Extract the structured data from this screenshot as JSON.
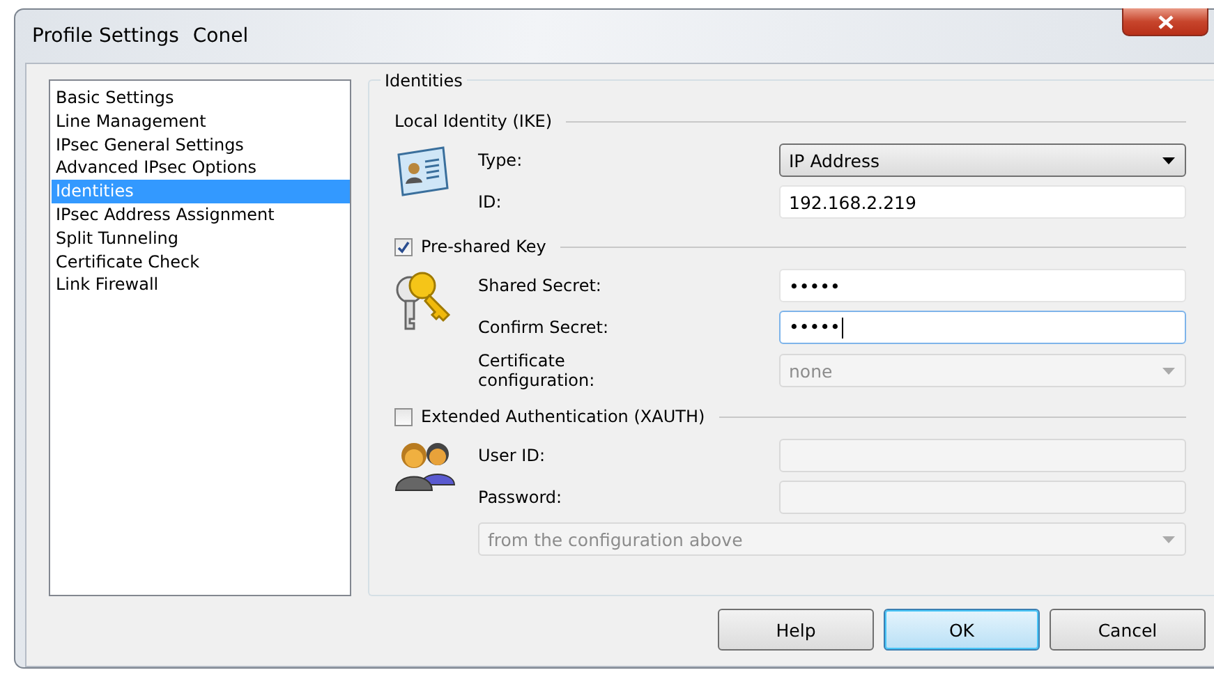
{
  "window": {
    "title": "Profile Settings",
    "subtitle": "Conel"
  },
  "nav": {
    "items": [
      {
        "label": "Basic Settings",
        "selected": false
      },
      {
        "label": "Line Management",
        "selected": false
      },
      {
        "label": "IPsec General Settings",
        "selected": false
      },
      {
        "label": "Advanced IPsec Options",
        "selected": false
      },
      {
        "label": "Identities",
        "selected": true
      },
      {
        "label": "IPsec Address Assignment",
        "selected": false
      },
      {
        "label": "Split Tunneling",
        "selected": false
      },
      {
        "label": "Certificate Check",
        "selected": false
      },
      {
        "label": "Link Firewall",
        "selected": false
      }
    ]
  },
  "group": {
    "title": "Identities",
    "sections": [
      {
        "kind": "plain",
        "title": "Local Identity (IKE)",
        "fields": [
          {
            "kind": "dropdown",
            "label": "Type:",
            "value": "IP Address",
            "disabled": false,
            "focused": false
          },
          {
            "kind": "text",
            "label": "ID:",
            "value": "192.168.2.219",
            "disabled": false,
            "focused": false
          }
        ]
      },
      {
        "kind": "checkbox",
        "title": "Pre-shared Key",
        "checked": true,
        "fields": [
          {
            "kind": "text",
            "label": "Shared Secret:",
            "value": "•••••",
            "disabled": false,
            "focused": false
          },
          {
            "kind": "text",
            "label": "Confirm Secret:",
            "value": "•••••",
            "disabled": false,
            "focused": true
          },
          {
            "kind": "dropdown",
            "label": "Certificate configuration:",
            "value": "none",
            "disabled": true,
            "focused": false
          }
        ]
      },
      {
        "kind": "checkbox",
        "title": "Extended Authentication (XAUTH)",
        "checked": false,
        "fields": [
          {
            "kind": "text",
            "label": "User ID:",
            "disabled": true,
            "focused": false
          },
          {
            "kind": "text",
            "label": "Password:",
            "disabled": true,
            "focused": false
          },
          {
            "kind": "wide-dropdown",
            "value": "from the configuration above",
            "disabled": true,
            "focused": false
          }
        ]
      }
    ]
  },
  "buttons": [
    {
      "label": "Help",
      "default": false
    },
    {
      "label": "OK",
      "default": true
    },
    {
      "label": "Cancel",
      "default": false
    }
  ]
}
